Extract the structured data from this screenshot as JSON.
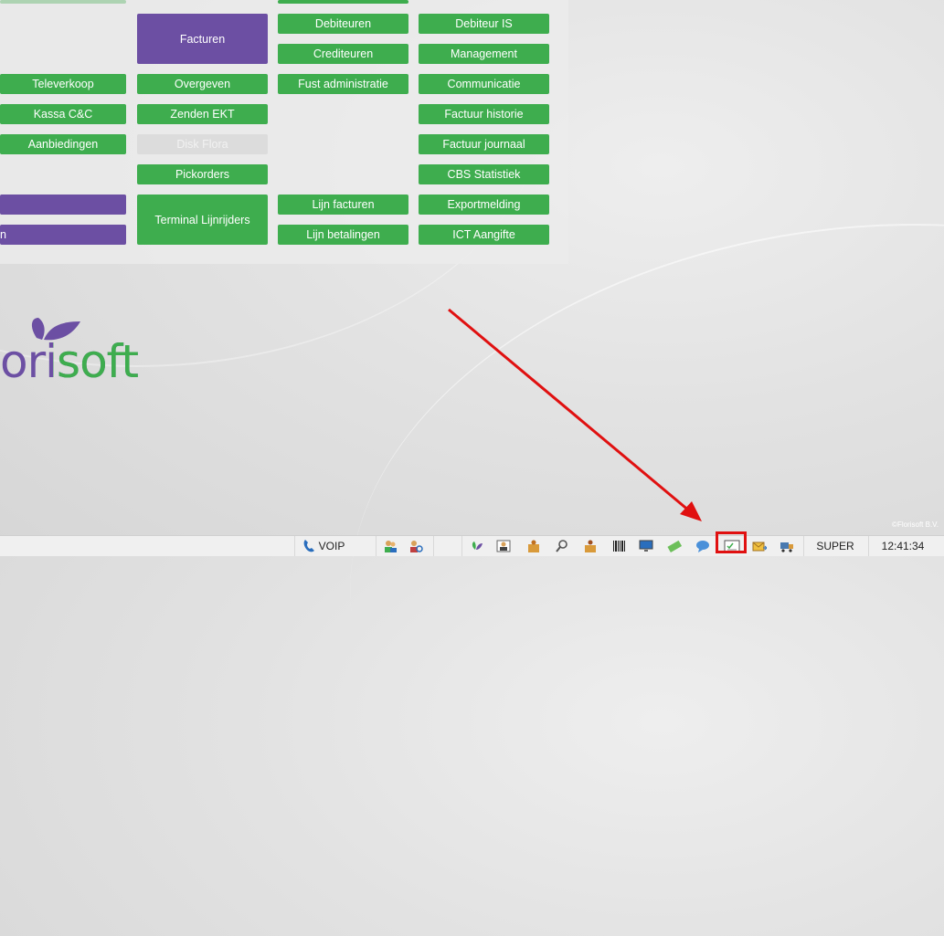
{
  "menu": {
    "col1": {
      "televerkoop": "Televerkoop",
      "kassa": "Kassa C&C",
      "aanbiedingen": "Aanbiedingen",
      "purple2_text": "n"
    },
    "col2": {
      "facturen": "Facturen",
      "overgeven": "Overgeven",
      "zenden_ekt": "Zenden EKT",
      "disk_flora": "Disk Flora",
      "pickorders": "Pickorders",
      "terminal": "Terminal Lijnrijders"
    },
    "col3": {
      "debiteuren": "Debiteuren",
      "crediteuren": "Crediteuren",
      "fust": "Fust administratie",
      "lijn_facturen": "Lijn facturen",
      "lijn_betalingen": "Lijn betalingen"
    },
    "col4": {
      "debiteur_is": "Debiteur IS",
      "management": "Management",
      "communicatie": "Communicatie",
      "factuur_historie": "Factuur historie",
      "factuur_journaal": "Factuur journaal",
      "cbs": "CBS Statistiek",
      "exportmelding": "Exportmelding",
      "ict": "ICT Aangifte"
    }
  },
  "logo": {
    "text": "orisoft"
  },
  "copyright": "©Florisoft B.V.",
  "taskbar": {
    "voip": "VOIP",
    "user": "SUPER",
    "time": "12:41:34"
  },
  "colors": {
    "green": "#3ead4e",
    "purple": "#6c4fa3",
    "highlight": "#e01010"
  }
}
